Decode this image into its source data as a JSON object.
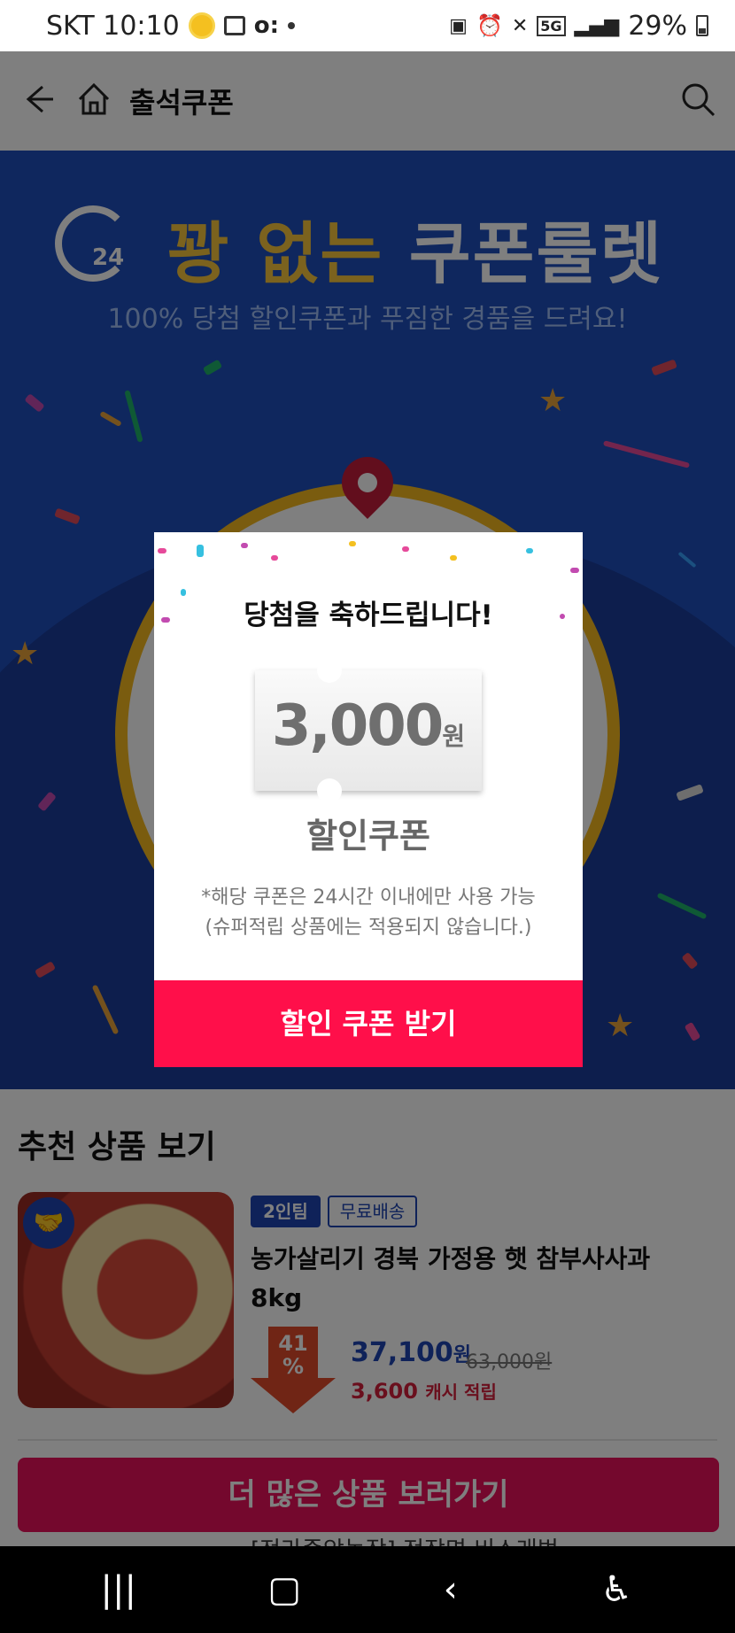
{
  "status_bar": {
    "carrier_time": "SKT 10:10",
    "network": "5G",
    "battery": "29%"
  },
  "header": {
    "title": "출석쿠폰"
  },
  "banner": {
    "headline_accent": "꽝 없는",
    "headline_main": "쿠폰룰렛",
    "clock_label": "24",
    "subtitle": "100% 당첨 할인쿠폰과 푸짐한 경품을 드려요!"
  },
  "modal": {
    "title": "당첨을 축하드립니다!",
    "amount": "3,000",
    "unit": "원",
    "coupon_label": "할인쿠폰",
    "note_line1": "*해당 쿠폰은 24시간 이내에만 사용 가능",
    "note_line2": "(슈퍼적립 상품에는 적용되지 않습니다.)",
    "cta": "할인 쿠폰 받기"
  },
  "recommended": {
    "section_title": "추천 상품 보기",
    "product": {
      "tag_team": "2인팀",
      "tag_shipping": "무료배송",
      "name": "농가살리기 경북 가정용 햇 참부사사과 8kg",
      "discount_number": "41",
      "discount_unit": "%",
      "price": "37,100",
      "price_unit": "원",
      "original_price": "63,000원",
      "cash_amount": "3,600",
      "cash_label": "캐시 적립"
    },
    "more_button": "더 많은 상품 보러가기",
    "next_item_partial": "[전라중앙농작] 전장면 비스래법"
  },
  "colors": {
    "banner_blue": "#1f4fbd",
    "accent_yellow": "#f7c53c",
    "cta_red": "#ff0f4a",
    "price_blue": "#1e44b3"
  }
}
